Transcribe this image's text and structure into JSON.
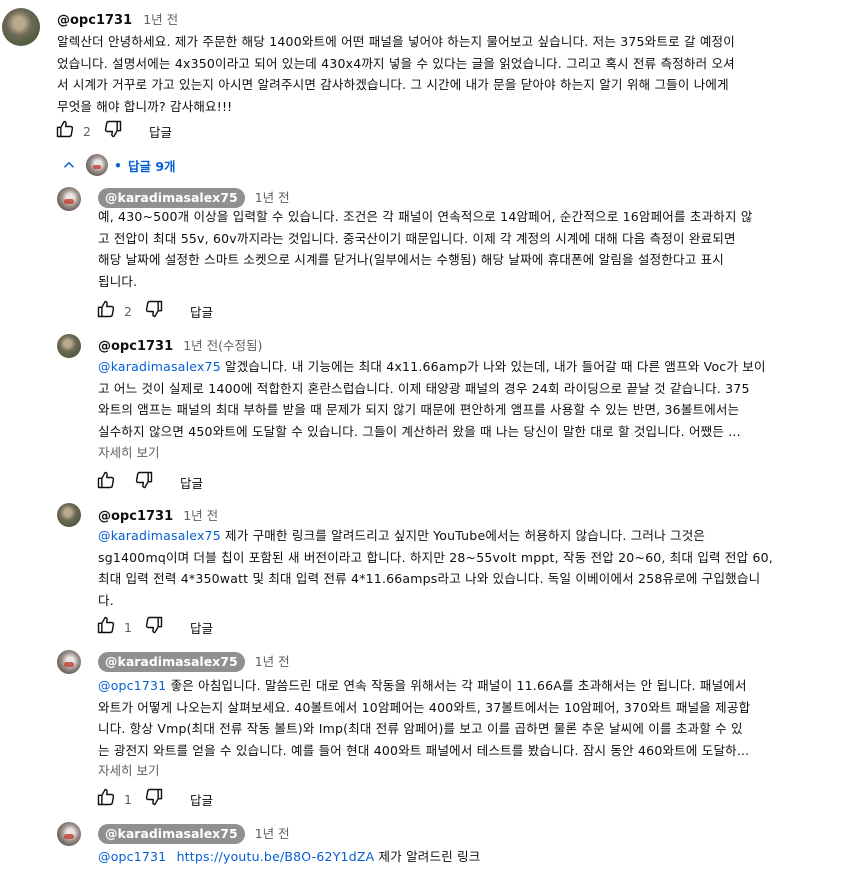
{
  "top_comment": {
    "author": "@opc1731",
    "time": "1년 전",
    "lines": [
      "알렉산더 안녕하세요. 제가 주문한 해당 1400와트에 어떤 패널을 넣어야 하는지 물어보고 싶습니다. 저는 375와트로 갈 예정이",
      "었습니다. 설명서에는 4x350이라고 되어 있는데 430x4까지 넣을 수 있다는 글을 읽었습니다. 그리고 혹시 전류 측정하러 오셔",
      "서 시계가 거꾸로 가고 있는지 아시면 알려주시면 감사하겠습니다. 그 시간에 내가 문을 닫아야 하는지 알기 위해 그들이 나에게",
      "무엇을 해야 합니까? 감사해요!!!"
    ],
    "likes": "2",
    "reply_label": "답글"
  },
  "replies_toggle": {
    "dot": "•",
    "label": "답글 9개"
  },
  "replies": [
    {
      "author": "@karadimasalex75",
      "time": "1년 전",
      "lines": [
        "예, 430~500개 이상을 입력할 수 있습니다. 조건은 각 패널이 연속적으로 14암페어, 순간적으로 16암페어를 초과하지 않",
        "고 전압이 최대 55v, 60v까지라는 것입니다. 중국산이기 때문입니다. 이제 각 계정의 시계에 대해 다음 측정이 완료되면",
        "해당 날짜에 설정한 스마트 소켓으로 시계를 닫거나(일부에서는 수행됨) 해당 날짜에 휴대폰에 알림을 설정한다고 표시",
        "됩니다."
      ],
      "likes": "2",
      "reply_label": "답글"
    },
    {
      "author": "@opc1731",
      "time": "1년 전(수정됨)",
      "mention": "@karadimasalex75",
      "first_text": "알겠습니다. 내 기능에는 최대 4x11.66amp가 나와 있는데, 내가 들어갈 때 다른 앰프와 Voc가 보이",
      "lines": [
        "고 어느 것이 실제로 1400에 적합한지 혼란스럽습니다. 이제 태양광 패널의 경우 24회 라이딩으로 끝날 것 같습니다. 375",
        "와트의 앰프는 패널의 최대 부하를 받을 때 문제가 되지 않기 때문에 편안하게 앰프를 사용할 수 있는 반면, 36볼트에서는",
        "실수하지 않으면 450와트에 도달할 수 있습니다. 그들이 계산하러 왔을 때 나는 당신이 말한 대로 할 것입니다. 어쨌든 ..."
      ],
      "more": "자세히 보기",
      "likes": "",
      "reply_label": "답글"
    },
    {
      "author": "@opc1731",
      "time": "1년 전",
      "mention": "@karadimasalex75",
      "first_text": "제가 구매한 링크를 알려드리고 싶지만 YouTube에서는 허용하지 않습니다. 그러나 그것은",
      "lines": [
        "sg1400mq이며 더블 칩이 포함된 새 버전이라고 합니다. 하지만 28~55volt mppt, 작동 전압 20~60, 최대 입력 전압 60,",
        "최대 입력 전력 4*350watt 및 최대 입력 전류 4*11.66amps라고 나와 있습니다. 독일 이베이에서 258유로에 구입했습니",
        "다."
      ],
      "likes": "1",
      "reply_label": "답글"
    },
    {
      "author": "@karadimasalex75",
      "time": "1년 전",
      "mention": "@opc1731",
      "first_text": "좋은 아침입니다. 말씀드린 대로 연속 작동을 위해서는 각 패널이 11.66A를 초과해서는 안 됩니다. 패널에서",
      "lines": [
        "와트가 어떻게 나오는지 살펴보세요. 40볼트에서 10암페어는 400와트, 37볼트에서는 10암페어, 370와트 패널을 제공합",
        "니다. 항상 Vmp(최대 전류 작동 볼트)와 Imp(최대 전류 암페어)를 보고 이를 곱하면 물론 추운 날씨에 이를 초과할 수 있",
        "는 광전지 와트를 얻을 수 있습니다. 예를 들어 현대 400와트 패널에서 테스트를 봤습니다. 잠시 동안 460와트에 도달하..."
      ],
      "more": "자세히 보기",
      "likes": "1",
      "reply_label": "답글"
    },
    {
      "author": "@karadimasalex75",
      "time": "1년 전",
      "mention": "@opc1731",
      "link": "https://youtu.be/B8O-62Y1dZA",
      "first_text": "제가 알려드린 링크"
    }
  ],
  "colors": {
    "text": "#0f0f0f",
    "secondary": "#606060",
    "link": "#065fd4",
    "chip_bg": "#909090"
  }
}
